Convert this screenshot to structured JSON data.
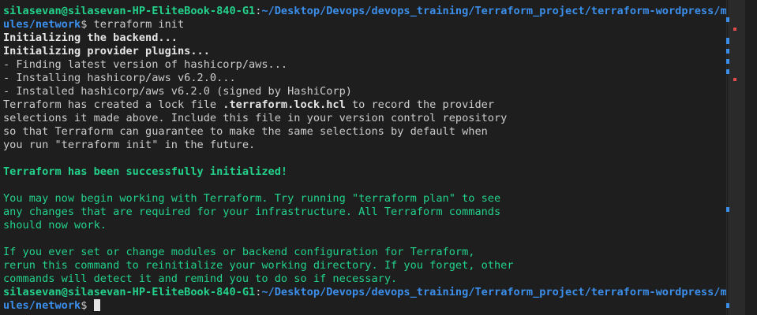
{
  "prompt": {
    "user_host": "silasevan@silasevan-HP-EliteBook-840-G1",
    "colon": ":",
    "path_part1": "~/Desktop/Devops/devops_training/Terraform_project/terraform-wordpress/mod",
    "path_part2": "ules/network",
    "dollar": "$"
  },
  "command": " terraform init",
  "output": {
    "init_backend": "Initializing the backend...",
    "init_plugins": "Initializing provider plugins...",
    "plugin_lines": [
      "- Finding latest version of hashicorp/aws...",
      "- Installing hashicorp/aws v6.2.0...",
      "- Installed hashicorp/aws v6.2.0 (signed by HashiCorp)"
    ],
    "lock_line_pre": "Terraform has created a lock file ",
    "lock_file": ".terraform.lock.hcl",
    "lock_line_post": " to record the provider",
    "lock_rest": [
      "selections it made above. Include this file in your version control repository",
      "so that Terraform can guarantee to make the same selections by default when",
      "you run \"terraform init\" in the future."
    ],
    "success": "Terraform has been successfully initialized!",
    "next_steps": [
      "You may now begin working with Terraform. Try running \"terraform plan\" to see",
      "any changes that are required for your infrastructure. All Terraform commands",
      "should now work."
    ],
    "reinit": [
      "If you ever set or change modules or backend configuration for Terraform,",
      "rerun this command to reinitialize your working directory. If you forget, other",
      "commands will detect it and remind you to do so if necessary."
    ]
  },
  "colors": {
    "background": "#1e1e1e",
    "text": "#cccccc",
    "green": "#23d18b",
    "blue": "#3b8eea",
    "error_marker": "#e44b4b"
  }
}
